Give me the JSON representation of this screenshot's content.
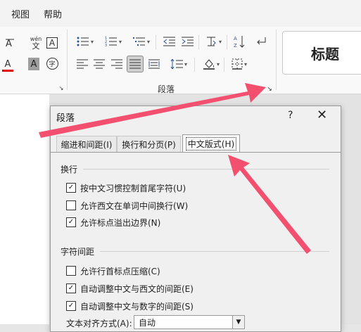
{
  "menu": {
    "items": [
      {
        "label": "视图"
      },
      {
        "label": "帮助"
      }
    ]
  },
  "ribbon": {
    "paragraph_group_label": "段落",
    "style_preview": "标题",
    "icons": {
      "row1": [
        "bullets-icon",
        "numbering-icon",
        "multilevel-list-icon",
        "decrease-indent-icon",
        "increase-indent-icon",
        "chinese-layout-icon",
        "sort-icon",
        "show-marks-icon"
      ],
      "row2": [
        "align-left-icon",
        "align-center-icon",
        "align-right-icon",
        "justify-icon",
        "distributed-icon",
        "line-spacing-icon",
        "shading-icon",
        "borders-icon"
      ]
    },
    "font_glyphs": {
      "phonetic": "wén",
      "phonetic_char": "文",
      "border_char": "A",
      "color_char": "A",
      "shade_char": "A",
      "enclose_char": "字"
    }
  },
  "dialog": {
    "title": "段落",
    "help": "?",
    "close": "✕",
    "tabs": [
      {
        "label": "缩进和间距(I)"
      },
      {
        "label": "换行和分页(P)"
      },
      {
        "label": "中文版式(H)"
      }
    ],
    "section_line_break": "换行",
    "line_break_options": [
      {
        "label": "按中文习惯控制首尾字符(U)",
        "checked": true
      },
      {
        "label": "允许西文在单词中间换行(W)",
        "checked": false
      },
      {
        "label": "允许标点溢出边界(N)",
        "checked": true
      }
    ],
    "section_char_spacing": "字符间距",
    "char_spacing_options": [
      {
        "label": "允许行首标点压缩(C)",
        "checked": false
      },
      {
        "label": "自动调整中文与西文的间距(E)",
        "checked": true
      },
      {
        "label": "自动调整中文与数字的间距(S)",
        "checked": true
      }
    ],
    "text_align_label": "文本对齐方式(A):",
    "text_align_value": "自动"
  },
  "colors": {
    "arrow": "#f2506e",
    "font_color_bar": "#e00000"
  }
}
